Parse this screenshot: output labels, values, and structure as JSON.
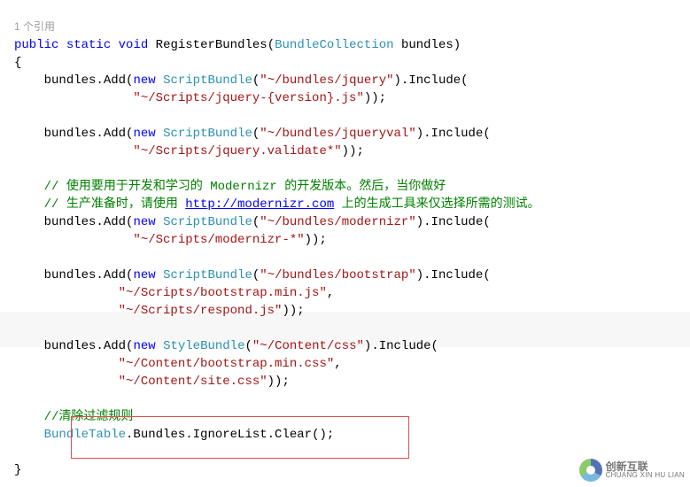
{
  "ref": "1 个引用",
  "sig": {
    "modifiers_public": "public",
    "modifiers_static": "static",
    "modifiers_void": "void",
    "name": "RegisterBundles",
    "param_type": "BundleCollection",
    "param_name": "bundles"
  },
  "c": {
    "bundles_add": "bundles.Add(",
    "new": "new",
    "script_bundle": "ScriptBundle",
    "style_bundle": "StyleBundle",
    "bundle_table": "BundleTable",
    "include": ").Include(",
    "end2": "));",
    "comma": ",",
    "open_brace": "{",
    "close_brace": "}",
    "lparen": "(",
    "rparen_semi": ");"
  },
  "s": {
    "jquery_bundle": "\"~/bundles/jquery\"",
    "jquery_script": "\"~/Scripts/jquery-{version}.js\"",
    "jqueryval_bundle": "\"~/bundles/jqueryval\"",
    "jqueryval_script": "\"~/Scripts/jquery.validate*\"",
    "modernizr_bundle": "\"~/bundles/modernizr\"",
    "modernizr_script": "\"~/Scripts/modernizr-*\"",
    "bootstrap_bundle": "\"~/bundles/bootstrap\"",
    "bootstrap_script1": "\"~/Scripts/bootstrap.min.js\"",
    "bootstrap_script2": "\"~/Scripts/respond.js\"",
    "css_bundle": "\"~/Content/css\"",
    "css_file1": "\"~/Content/bootstrap.min.css\"",
    "css_file2": "\"~/Content/site.css\""
  },
  "cm": {
    "mod1": "// 使用要用于开发和学习的 Modernizr 的开发版本。然后，当你做好",
    "mod2a": "// 生产准备时，请使用 ",
    "mod2_url": "http://modernizr.com",
    "mod2b": " 上的生成工具来仅选择所需的测试。",
    "clear": "//清除过滤规则"
  },
  "clear_call": ".Bundles.IgnoreList.Clear();",
  "watermark": {
    "cn": "创新互联",
    "en": "CHUANG XIN HU LIAN"
  }
}
